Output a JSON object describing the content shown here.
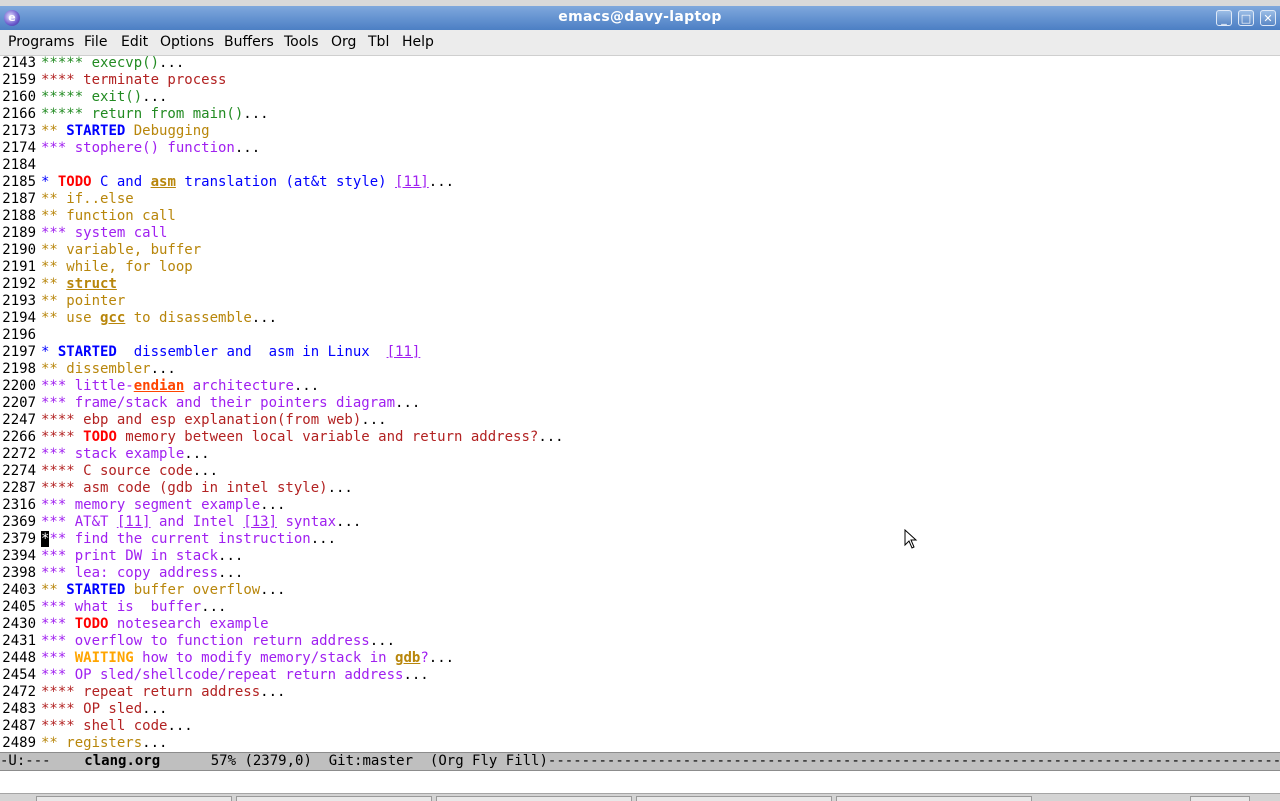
{
  "window": {
    "title": "emacs@davy-laptop",
    "controls": [
      "minimize",
      "maximize",
      "close"
    ],
    "app_icon": "emacs-icon"
  },
  "menubar": [
    "Programs",
    "File",
    "Edit",
    "Options",
    "Buffers",
    "Tools",
    "Org",
    "Tbl",
    "Help"
  ],
  "lines": [
    {
      "n": "2143",
      "segs": [
        {
          "t": "***** execvp()",
          "c": "c5"
        },
        {
          "t": "...",
          "c": "dots"
        }
      ]
    },
    {
      "n": "2159",
      "segs": [
        {
          "t": "**** terminate process",
          "c": "c4"
        }
      ]
    },
    {
      "n": "2160",
      "segs": [
        {
          "t": "***** exit()",
          "c": "c5"
        },
        {
          "t": "...",
          "c": "dots"
        }
      ]
    },
    {
      "n": "2166",
      "segs": [
        {
          "t": "***** return from main()",
          "c": "c5"
        },
        {
          "t": "...",
          "c": "dots"
        }
      ]
    },
    {
      "n": "2173",
      "segs": [
        {
          "t": "** ",
          "c": "c2"
        },
        {
          "t": "STARTED",
          "c": "kw"
        },
        {
          "t": " Debugging",
          "c": "c2"
        }
      ]
    },
    {
      "n": "2174",
      "segs": [
        {
          "t": "*** stophere() function",
          "c": "c3"
        },
        {
          "t": "...",
          "c": "dots"
        }
      ]
    },
    {
      "n": "2184",
      "segs": []
    },
    {
      "n": "2185",
      "segs": [
        {
          "t": "* ",
          "c": "c1"
        },
        {
          "t": "TODO",
          "c": "todo"
        },
        {
          "t": " C and ",
          "c": "c1"
        },
        {
          "t": "asm",
          "c": "under"
        },
        {
          "t": " translation (at&t style) ",
          "c": "c1"
        },
        {
          "t": "[11]",
          "c": "link"
        },
        {
          "t": "...",
          "c": "dots"
        }
      ]
    },
    {
      "n": "2187",
      "segs": [
        {
          "t": "** if..else",
          "c": "c2"
        }
      ]
    },
    {
      "n": "2188",
      "segs": [
        {
          "t": "** function call",
          "c": "c2"
        }
      ]
    },
    {
      "n": "2189",
      "segs": [
        {
          "t": "*** system call",
          "c": "c3"
        }
      ]
    },
    {
      "n": "2190",
      "segs": [
        {
          "t": "** variable, buffer",
          "c": "c2"
        }
      ]
    },
    {
      "n": "2191",
      "segs": [
        {
          "t": "** while, for loop",
          "c": "c2"
        }
      ]
    },
    {
      "n": "2192",
      "segs": [
        {
          "t": "** ",
          "c": "c2"
        },
        {
          "t": "struct",
          "c": "under"
        }
      ]
    },
    {
      "n": "2193",
      "segs": [
        {
          "t": "** pointer",
          "c": "c2"
        }
      ]
    },
    {
      "n": "2194",
      "segs": [
        {
          "t": "** use ",
          "c": "c2"
        },
        {
          "t": "gcc",
          "c": "under"
        },
        {
          "t": " to disassemble",
          "c": "c2"
        },
        {
          "t": "...",
          "c": "dots"
        }
      ]
    },
    {
      "n": "2196",
      "segs": []
    },
    {
      "n": "2197",
      "segs": [
        {
          "t": "* ",
          "c": "c1"
        },
        {
          "t": "STARTED",
          "c": "kw"
        },
        {
          "t": "  dissembler and  asm in Linux  ",
          "c": "c1"
        },
        {
          "t": "[11]",
          "c": "link"
        }
      ]
    },
    {
      "n": "2198",
      "segs": [
        {
          "t": "** dissembler",
          "c": "c2"
        },
        {
          "t": "...",
          "c": "dots"
        }
      ]
    },
    {
      "n": "2200",
      "segs": [
        {
          "t": "*** little-",
          "c": "c3"
        },
        {
          "t": "endian",
          "c": "uorange"
        },
        {
          "t": " architecture",
          "c": "c3"
        },
        {
          "t": "...",
          "c": "dots"
        }
      ]
    },
    {
      "n": "2207",
      "segs": [
        {
          "t": "*** frame/stack and their pointers diagram",
          "c": "c3"
        },
        {
          "t": "...",
          "c": "dots"
        }
      ]
    },
    {
      "n": "2247",
      "segs": [
        {
          "t": "**** ebp and esp explanation(from web)",
          "c": "c4"
        },
        {
          "t": "...",
          "c": "dots"
        }
      ]
    },
    {
      "n": "2266",
      "segs": [
        {
          "t": "**** ",
          "c": "c4"
        },
        {
          "t": "TODO",
          "c": "todo"
        },
        {
          "t": " memory between local variable and return address?",
          "c": "c4"
        },
        {
          "t": "...",
          "c": "dots"
        }
      ]
    },
    {
      "n": "2272",
      "segs": [
        {
          "t": "*** stack example",
          "c": "c3"
        },
        {
          "t": "...",
          "c": "dots"
        }
      ]
    },
    {
      "n": "2274",
      "segs": [
        {
          "t": "**** C source code",
          "c": "c4"
        },
        {
          "t": "...",
          "c": "dots"
        }
      ]
    },
    {
      "n": "2287",
      "segs": [
        {
          "t": "**** asm code (gdb in intel style)",
          "c": "c4"
        },
        {
          "t": "...",
          "c": "dots"
        }
      ]
    },
    {
      "n": "2316",
      "segs": [
        {
          "t": "*** memory segment example",
          "c": "c3"
        },
        {
          "t": "...",
          "c": "dots"
        }
      ]
    },
    {
      "n": "2369",
      "segs": [
        {
          "t": "*** AT&T ",
          "c": "c3"
        },
        {
          "t": "[11]",
          "c": "link"
        },
        {
          "t": " and Intel ",
          "c": "c3"
        },
        {
          "t": "[13]",
          "c": "link"
        },
        {
          "t": " syntax",
          "c": "c3"
        },
        {
          "t": "...",
          "c": "dots"
        }
      ]
    },
    {
      "n": "2379",
      "segs": [
        {
          "t": "*",
          "c": "cursor"
        },
        {
          "t": "** find the current instruction",
          "c": "c3"
        },
        {
          "t": "...",
          "c": "dots"
        }
      ]
    },
    {
      "n": "2394",
      "segs": [
        {
          "t": "*** print DW in stack",
          "c": "c3"
        },
        {
          "t": "...",
          "c": "dots"
        }
      ]
    },
    {
      "n": "2398",
      "segs": [
        {
          "t": "*** lea: copy address",
          "c": "c3"
        },
        {
          "t": "...",
          "c": "dots"
        }
      ]
    },
    {
      "n": "2403",
      "segs": [
        {
          "t": "** ",
          "c": "c2"
        },
        {
          "t": "STARTED",
          "c": "kw"
        },
        {
          "t": " buffer overflow",
          "c": "c2"
        },
        {
          "t": "...",
          "c": "dots"
        }
      ]
    },
    {
      "n": "2405",
      "segs": [
        {
          "t": "*** what is  buffer",
          "c": "c3"
        },
        {
          "t": "...",
          "c": "dots"
        }
      ]
    },
    {
      "n": "2430",
      "segs": [
        {
          "t": "*** ",
          "c": "c3"
        },
        {
          "t": "TODO",
          "c": "todo"
        },
        {
          "t": " notesearch example",
          "c": "c3"
        }
      ]
    },
    {
      "n": "2431",
      "segs": [
        {
          "t": "*** overflow to function return address",
          "c": "c3"
        },
        {
          "t": "...",
          "c": "dots"
        }
      ]
    },
    {
      "n": "2448",
      "segs": [
        {
          "t": "*** ",
          "c": "c3"
        },
        {
          "t": "WAITING",
          "c": "wait"
        },
        {
          "t": " how to modify memory/stack in ",
          "c": "c3"
        },
        {
          "t": "gdb",
          "c": "under"
        },
        {
          "t": "?",
          "c": "c3"
        },
        {
          "t": "...",
          "c": "dots"
        }
      ]
    },
    {
      "n": "2454",
      "segs": [
        {
          "t": "*** OP sled/shellcode/repeat return address",
          "c": "c3"
        },
        {
          "t": "...",
          "c": "dots"
        }
      ]
    },
    {
      "n": "2472",
      "segs": [
        {
          "t": "**** repeat return address",
          "c": "c4"
        },
        {
          "t": "...",
          "c": "dots"
        }
      ]
    },
    {
      "n": "2483",
      "segs": [
        {
          "t": "**** OP sled",
          "c": "c4"
        },
        {
          "t": "...",
          "c": "dots"
        }
      ]
    },
    {
      "n": "2487",
      "segs": [
        {
          "t": "**** shell code",
          "c": "c4"
        },
        {
          "t": "...",
          "c": "dots"
        }
      ]
    },
    {
      "n": "2489",
      "segs": [
        {
          "t": "** registers",
          "c": "c2"
        },
        {
          "t": "...",
          "c": "dots"
        }
      ]
    }
  ],
  "modeline": {
    "status": "-U:---",
    "buffer_name": "clang.org",
    "position": "57% (2379,0)",
    "vcs": "Git:master",
    "modes": "(Org Fly Fill)"
  },
  "colors": {
    "level1": "#0000ff",
    "level2": "#b8860b",
    "level3": "#a020f0",
    "level4": "#b22222",
    "level5": "#228b22",
    "todo": "#ff0000",
    "modeline_bg": "#bfbfbf",
    "titlebar": "#4c7fc4"
  }
}
